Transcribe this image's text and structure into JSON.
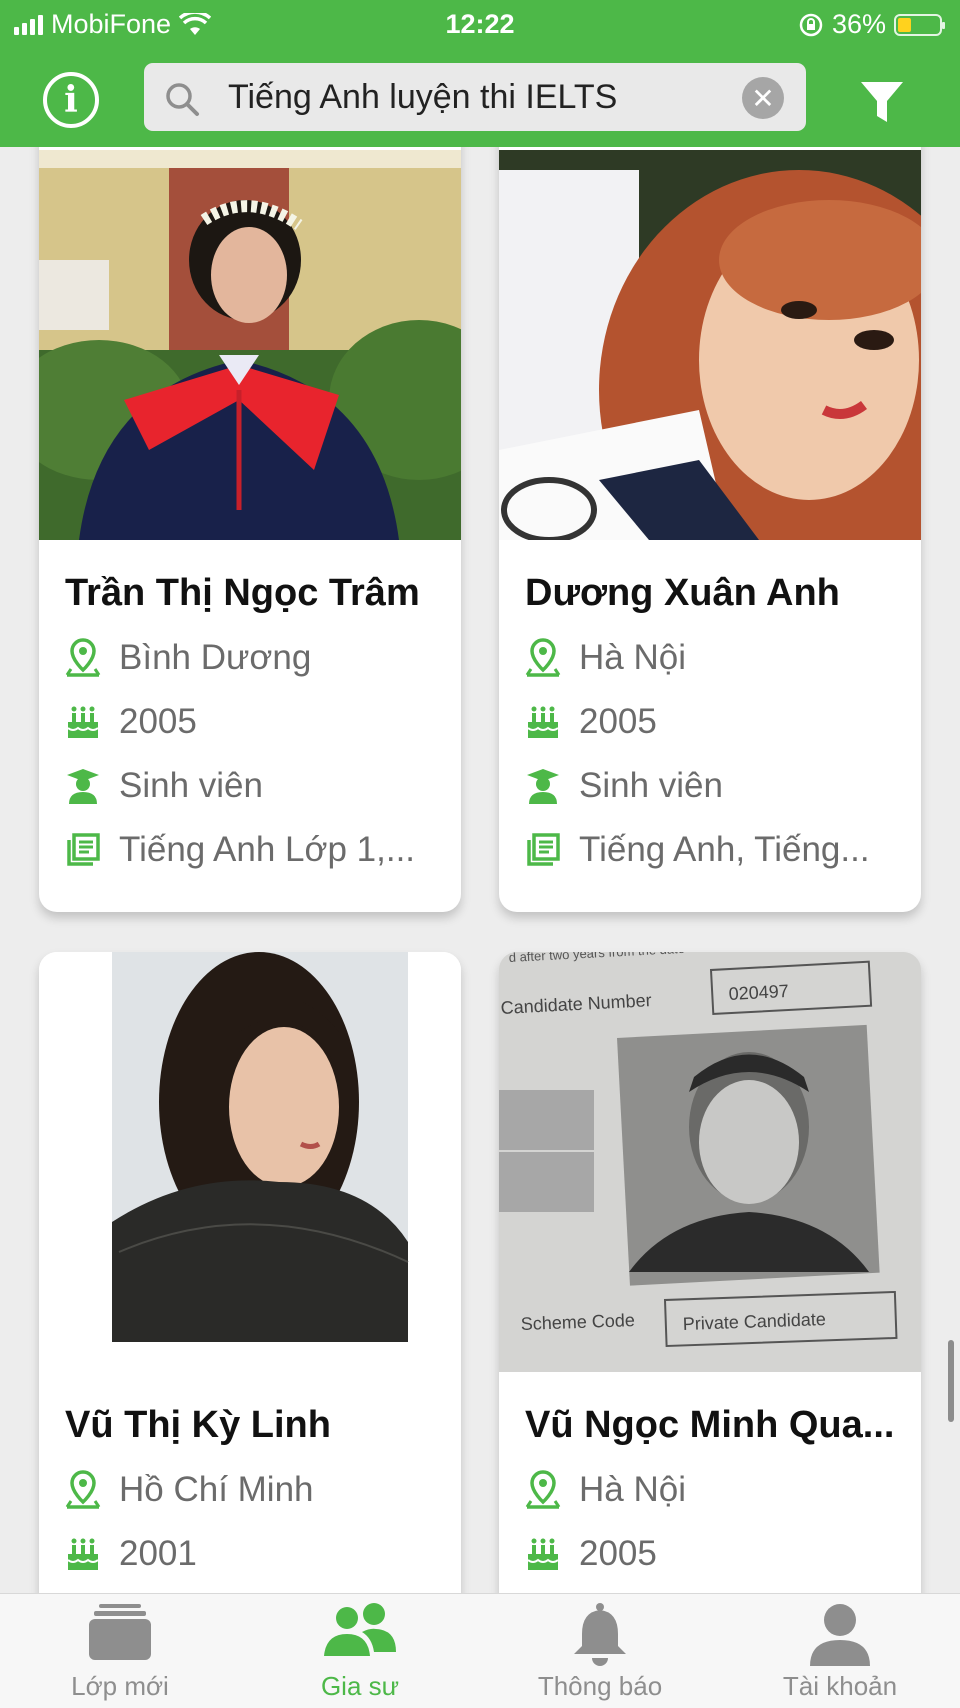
{
  "status": {
    "carrier": "MobiFone",
    "time": "12:22",
    "battery": "36%"
  },
  "search": {
    "query": "Tiếng Anh luyện thi IELTS"
  },
  "tutors": [
    {
      "name": "Trần Thị Ngọc Trâm",
      "location": "Bình Dương",
      "birth_year": "2005",
      "role": "Sinh viên",
      "subjects": "Tiếng Anh Lớp 1,..."
    },
    {
      "name": "Dương Xuân Anh",
      "location": "Hà Nội",
      "birth_year": "2005",
      "role": "Sinh viên",
      "subjects": "Tiếng Anh, Tiếng..."
    },
    {
      "name": "Vũ Thị Kỳ Linh",
      "location": "Hồ Chí Minh",
      "birth_year": "2001"
    },
    {
      "name": "Vũ Ngọc Minh Qua...",
      "location": "Hà Nội",
      "birth_year": "2005",
      "photo_text": {
        "candidate_label": "Candidate Number",
        "candidate_number": "020497",
        "scheme_label": "Scheme Code",
        "scheme_value": "Private Candidate",
        "top_text": "d after two years from the date"
      }
    }
  ],
  "tabs": [
    {
      "label": "Lớp mới",
      "icon": "class-icon",
      "active": false
    },
    {
      "label": "Gia sư",
      "icon": "tutors-icon",
      "active": true
    },
    {
      "label": "Thông báo",
      "icon": "bell-icon",
      "active": false
    },
    {
      "label": "Tài khoản",
      "icon": "account-icon",
      "active": false
    }
  ],
  "colors": {
    "brand": "#4db848",
    "inactive": "#8e8e8e",
    "battery": "#ffd21e"
  }
}
